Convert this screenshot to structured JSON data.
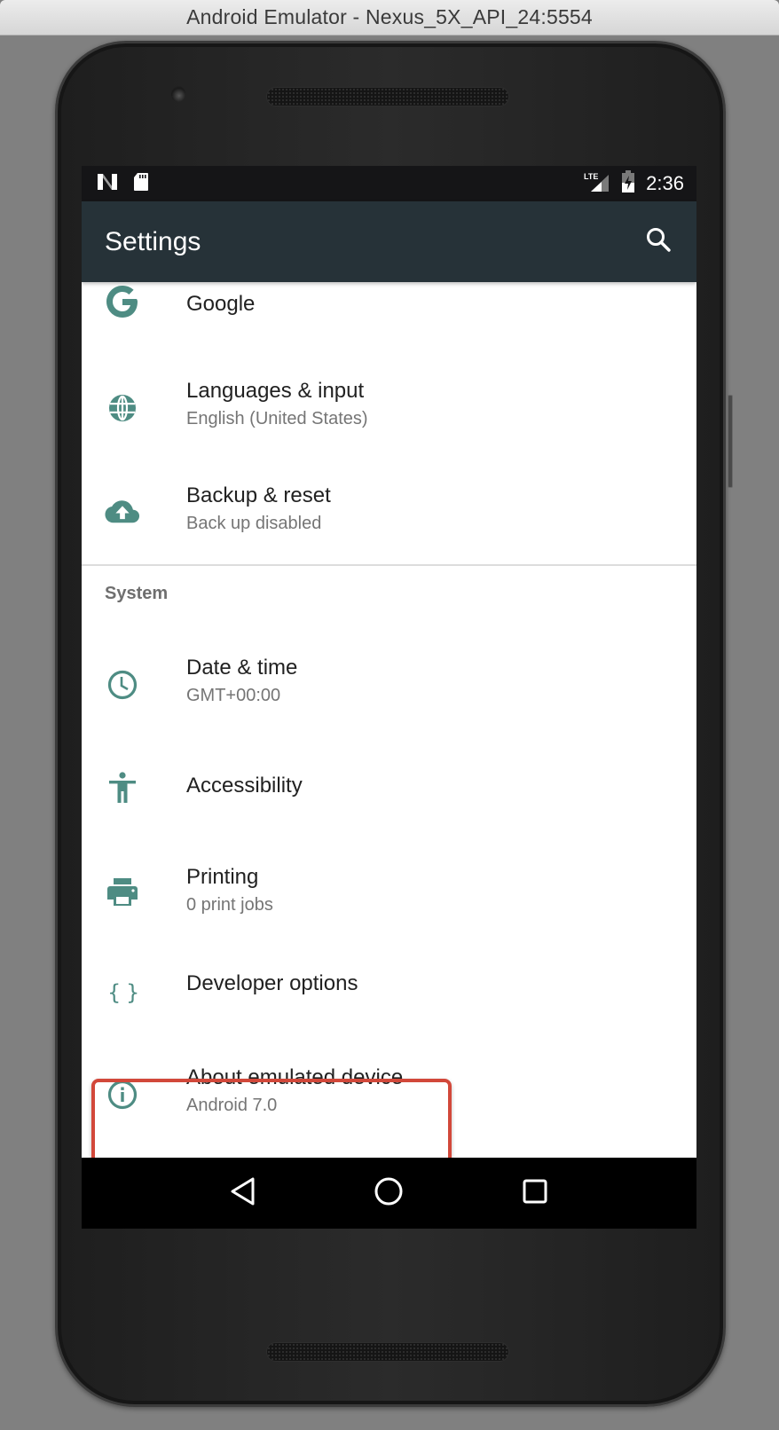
{
  "window": {
    "title": "Android Emulator - Nexus_5X_API_24:5554"
  },
  "status_bar": {
    "left_icons": [
      "android-n-icon",
      "sd-card-icon"
    ],
    "right_icons": [
      "lte-signal-icon",
      "battery-charging-icon"
    ],
    "network_label": "LTE",
    "time": "2:36"
  },
  "toolbar": {
    "title": "Settings",
    "action_icon": "search-icon"
  },
  "list": {
    "personal_items": [
      {
        "id": "google",
        "title": "Google",
        "subtitle": null,
        "icon": "google-g-icon"
      },
      {
        "id": "languages",
        "title": "Languages & input",
        "subtitle": "English (United States)",
        "icon": "globe-icon"
      },
      {
        "id": "backup",
        "title": "Backup & reset",
        "subtitle": "Back up disabled",
        "icon": "cloud-upload-icon"
      }
    ],
    "system_section": {
      "header": "System",
      "items": [
        {
          "id": "date-time",
          "title": "Date & time",
          "subtitle": "GMT+00:00",
          "icon": "clock-icon"
        },
        {
          "id": "accessibility",
          "title": "Accessibility",
          "subtitle": null,
          "icon": "accessibility-icon"
        },
        {
          "id": "printing",
          "title": "Printing",
          "subtitle": "0 print jobs",
          "icon": "printer-icon"
        },
        {
          "id": "developer",
          "title": "Developer options",
          "subtitle": null,
          "icon": "braces-icon",
          "highlighted": true
        },
        {
          "id": "about",
          "title": "About emulated device",
          "subtitle": "Android 7.0",
          "icon": "info-icon"
        }
      ]
    }
  },
  "nav_bar": {
    "buttons": [
      "back-icon",
      "home-icon",
      "recents-icon"
    ]
  },
  "colors": {
    "accent_icon": "#4e8c83",
    "toolbar_bg": "#263238",
    "status_bar_bg": "#151517",
    "highlight_border": "#d2483a",
    "nav_bar_bg": "#000000"
  }
}
